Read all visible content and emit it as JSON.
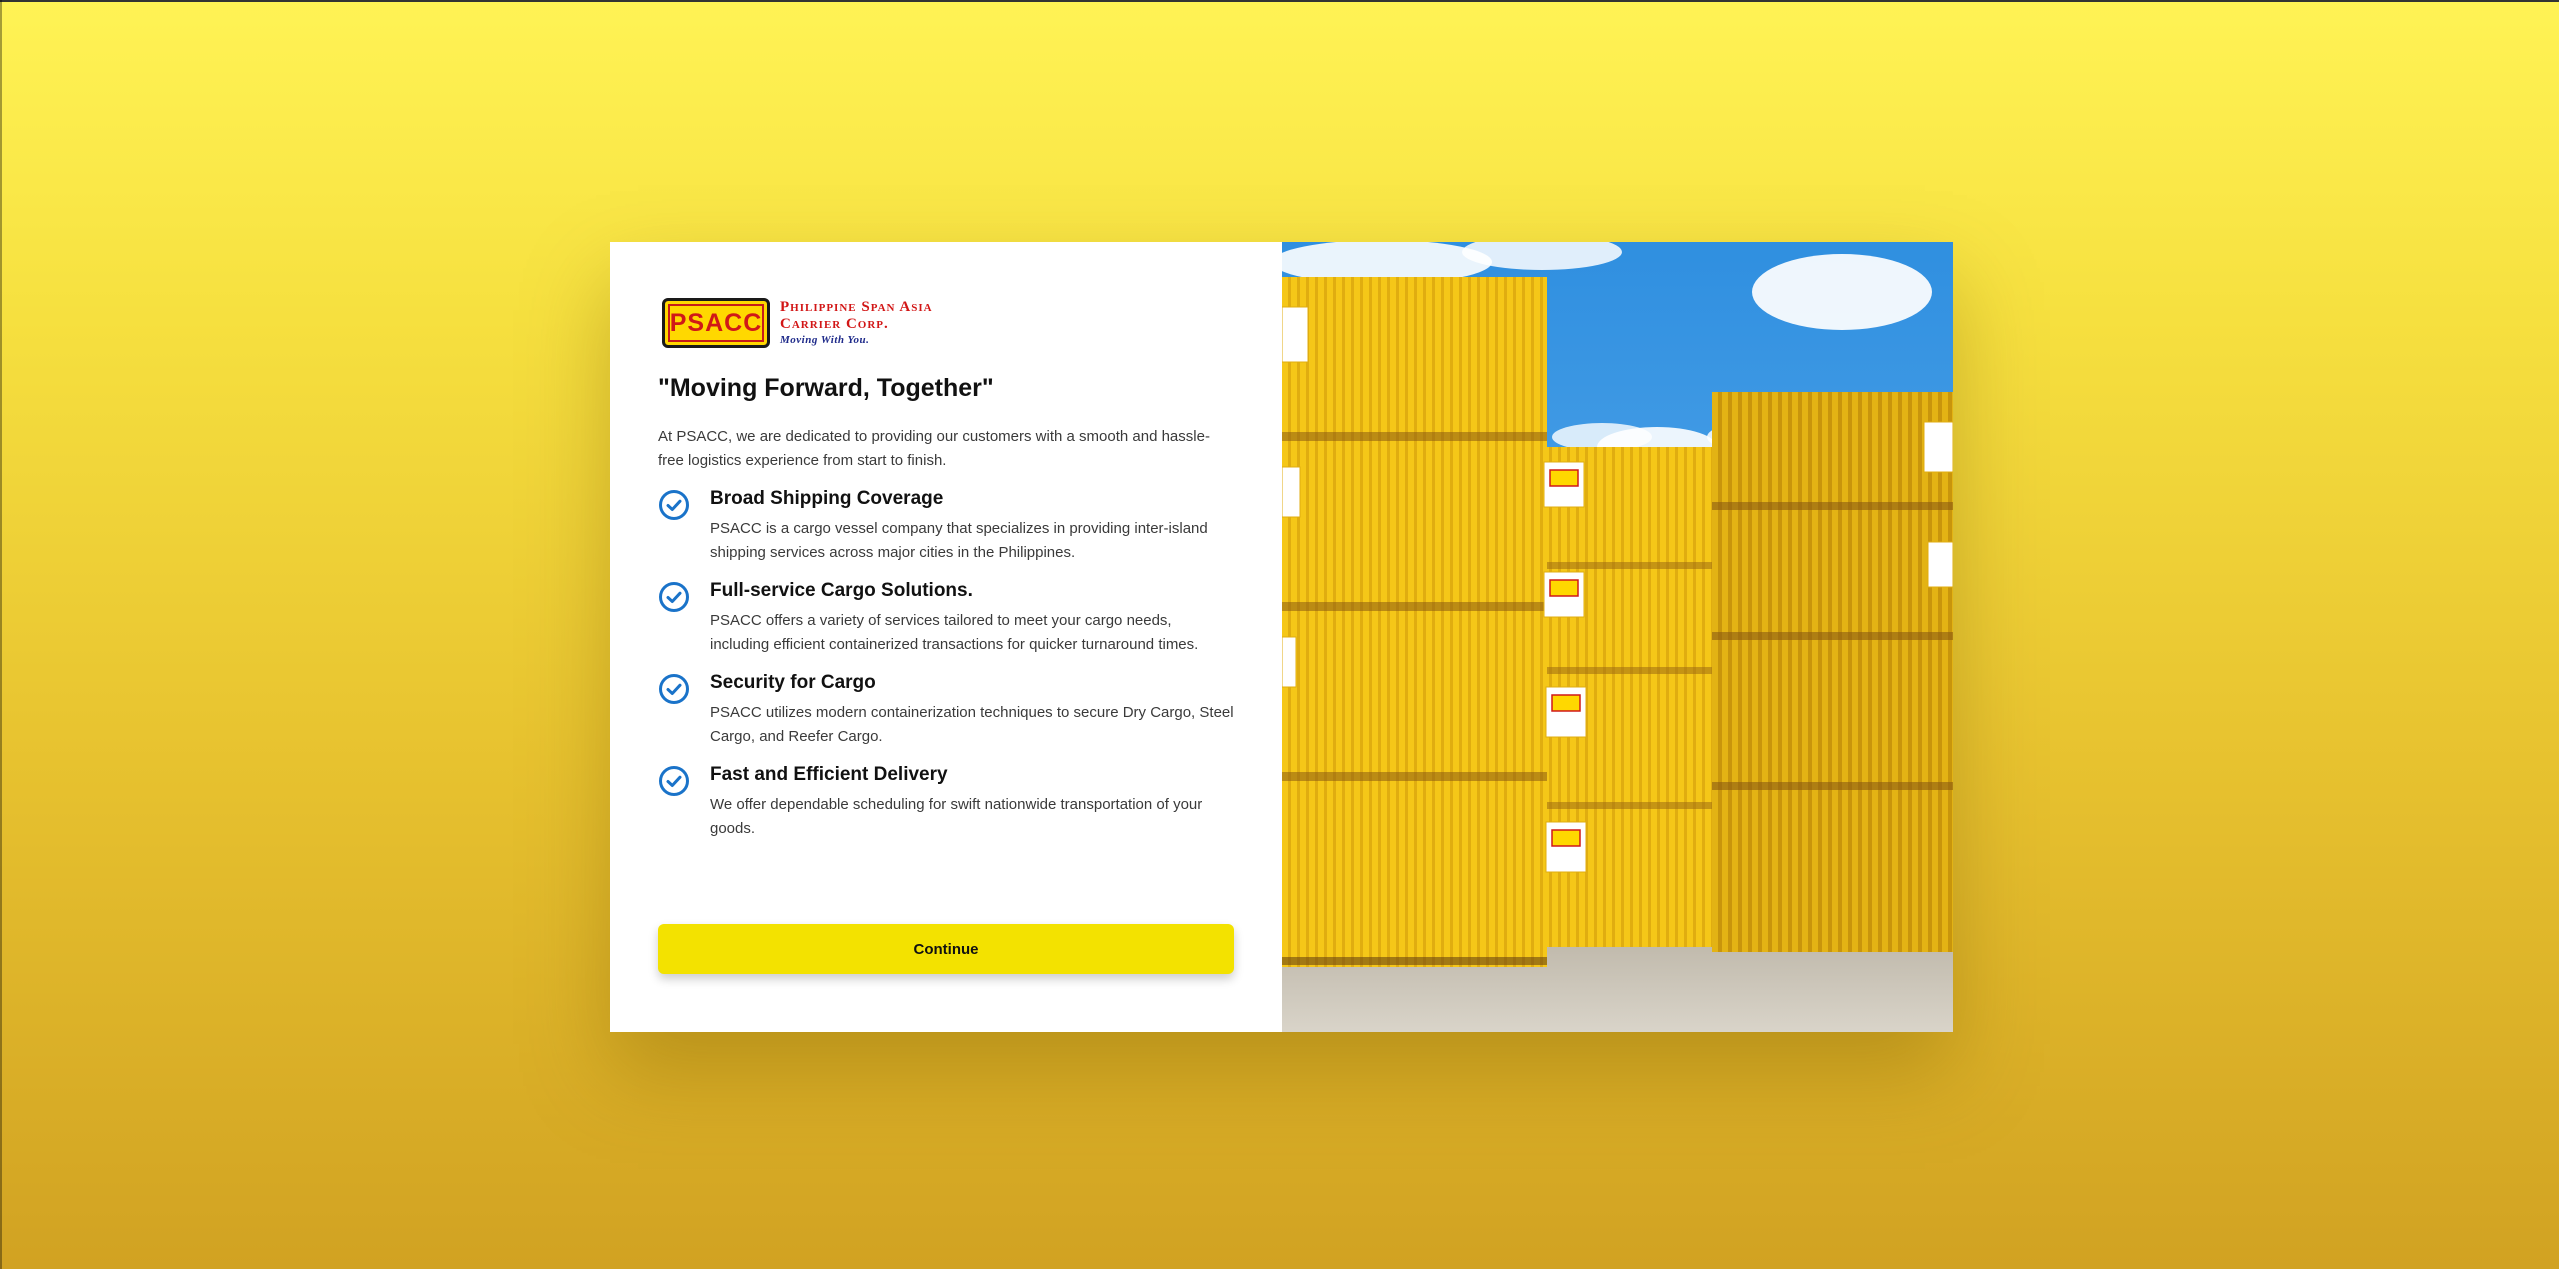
{
  "logo": {
    "mark_text": "PSACC",
    "line1": "Philippine Span Asia",
    "line2": "Carrier Corp.",
    "tagline": "Moving With You."
  },
  "headline": "\"Moving Forward, Together\"",
  "intro": "At PSACC, we are dedicated to providing our customers with a smooth and hassle-free logistics experience from start to finish.",
  "features": [
    {
      "icon": "check-circle-icon",
      "title": "Broad Shipping Coverage",
      "description": "PSACC is a cargo vessel company that specializes in providing inter-island shipping services across major cities in the Philippines."
    },
    {
      "icon": "check-circle-icon",
      "title": "Full-service Cargo Solutions.",
      "description": "PSACC offers a variety of services tailored to meet your cargo needs, including efficient containerized transactions for quicker turnaround times."
    },
    {
      "icon": "check-circle-icon",
      "title": "Security for Cargo",
      "description": "PSACC utilizes modern containerization techniques to secure Dry Cargo, Steel Cargo, and Reefer Cargo."
    },
    {
      "icon": "check-circle-icon",
      "title": "Fast and Efficient Delivery",
      "description": "We offer dependable scheduling for swift nationwide transportation of your goods."
    }
  ],
  "continue_label": "Continue",
  "colors": {
    "accent": "#f3e200",
    "check_blue": "#1a73c9",
    "brand_red": "#d21616",
    "brand_navy": "#1e2a8a"
  }
}
